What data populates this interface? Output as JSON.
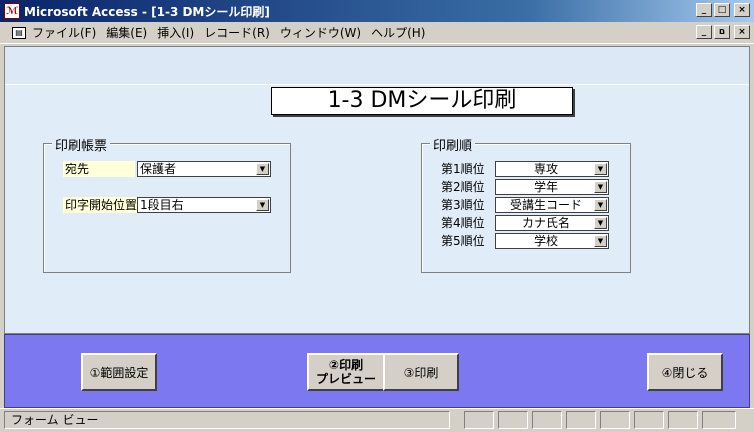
{
  "window": {
    "title": "Microsoft Access - [1-3 DMシール印刷]",
    "app_icon": "access-icon",
    "minimize": "_",
    "maximize": "□",
    "close": "×",
    "restore": "ם"
  },
  "menubar": {
    "form_icon": "form-icon",
    "items": [
      "ファイル(F)",
      "編集(E)",
      "挿入(I)",
      "レコード(R)",
      "ウィンドウ(W)",
      "ヘルプ(H)"
    ]
  },
  "form": {
    "title": "1-3  DMシール印刷",
    "background_color": "#e0ecf8",
    "footer_color": "#7b78f0"
  },
  "print_form_group": {
    "label": "印刷帳票",
    "destination_label": "宛先",
    "destination_value": "保護者",
    "start_position_label": "印字開始位置",
    "start_position_value": "1段目右"
  },
  "print_order_group": {
    "label": "印刷順",
    "rows": [
      {
        "label": "第1順位",
        "value": "専攻"
      },
      {
        "label": "第2順位",
        "value": "学年"
      },
      {
        "label": "第3順位",
        "value": "受講生コード"
      },
      {
        "label": "第4順位",
        "value": "カナ氏名"
      },
      {
        "label": "第5順位",
        "value": "学校"
      }
    ]
  },
  "footer_buttons": {
    "range": "①範囲設定",
    "preview_line1": "②印刷",
    "preview_line2": "プレビュー",
    "print": "③印刷",
    "close": "④閉じる"
  },
  "status": {
    "view": "フォーム ビュー"
  },
  "icons": {
    "dropdown": "▼"
  }
}
